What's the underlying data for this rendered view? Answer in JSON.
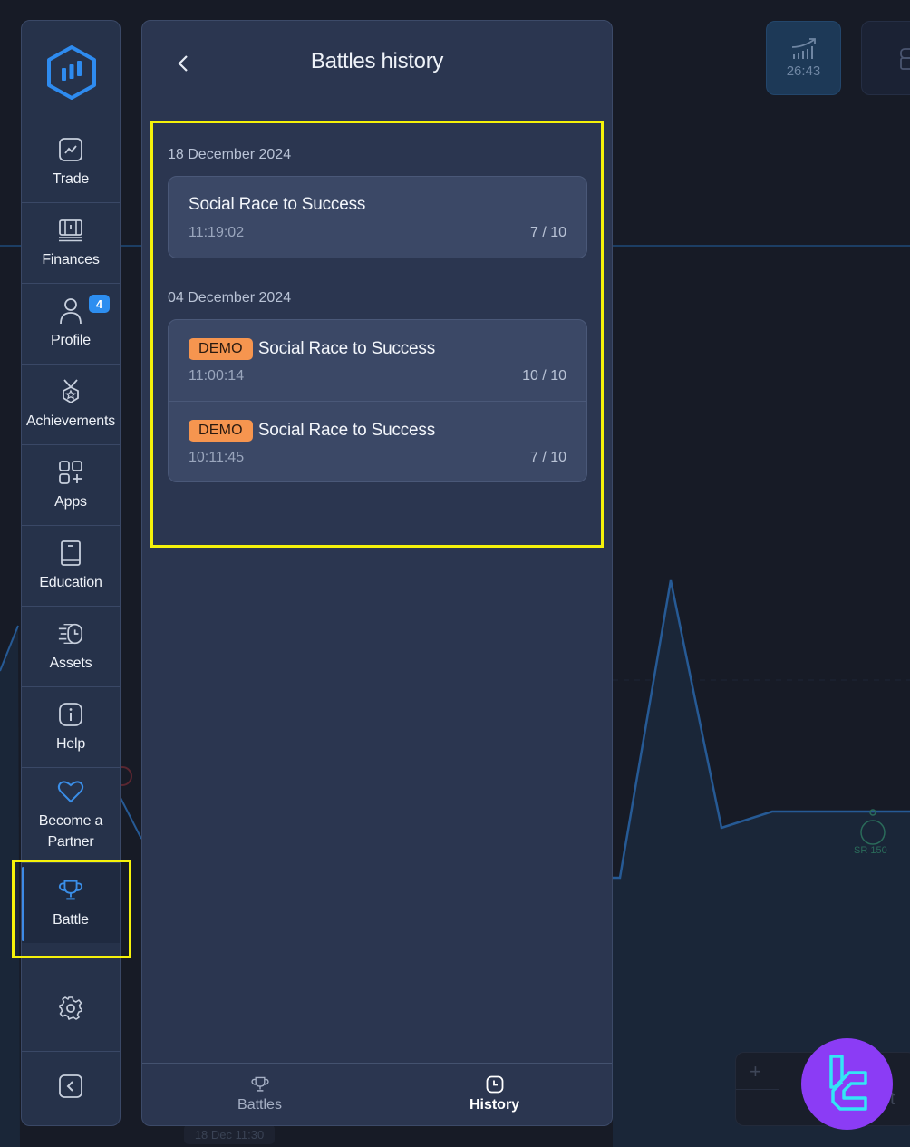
{
  "background": {
    "timer_widget": {
      "icon": "trend-bars-icon",
      "value": "26:43"
    },
    "chest_widget": {
      "icon": "treasure-chest-icon"
    },
    "chart_marker_label": "SR 150",
    "date_chip": "18 Dec 11:30",
    "zoom_plus": "+",
    "partial_text": "t"
  },
  "sidebar": {
    "logo": "hexagon-chart-logo",
    "items": [
      {
        "label": "Trade",
        "icon": "trade-chart-icon"
      },
      {
        "label": "Finances",
        "icon": "wallet-icon"
      },
      {
        "label": "Profile",
        "icon": "user-icon",
        "badge": "4"
      },
      {
        "label": "Achievements",
        "icon": "medal-icon"
      },
      {
        "label": "Apps",
        "icon": "apps-grid-icon"
      },
      {
        "label": "Education",
        "icon": "book-icon"
      },
      {
        "label": "Assets",
        "icon": "fast-clock-icon"
      },
      {
        "label": "Help",
        "icon": "info-icon"
      },
      {
        "label": "Become a Partner",
        "icon": "heart-icon"
      },
      {
        "label": "Battle",
        "icon": "trophy-icon",
        "active": true
      }
    ],
    "settings_icon": "gear-icon",
    "collapse_icon": "chevron-left-square-icon"
  },
  "panel": {
    "title": "Battles history",
    "back_icon": "chevron-left-icon",
    "groups": [
      {
        "date": "18 December 2024",
        "entries": [
          {
            "demo": false,
            "title": "Social Race to Success",
            "time": "11:19:02",
            "score": "7 / 10"
          }
        ]
      },
      {
        "date": "04 December 2024",
        "entries": [
          {
            "demo": true,
            "demo_label": "DEMO",
            "title": "Social Race to Success",
            "time": "11:00:14",
            "score": "10 / 10"
          },
          {
            "demo": true,
            "demo_label": "DEMO",
            "title": "Social Race to Success",
            "time": "10:11:45",
            "score": "7 / 10"
          }
        ]
      }
    ],
    "tabs": [
      {
        "label": "Battles",
        "icon": "trophy-icon",
        "active": false
      },
      {
        "label": "History",
        "icon": "clock-icon",
        "active": true
      }
    ]
  },
  "colors": {
    "accent": "#3d8ae6",
    "demo_badge": "#f6954f",
    "highlight": "#f5f20a",
    "watermark": "#8b3cf5"
  }
}
